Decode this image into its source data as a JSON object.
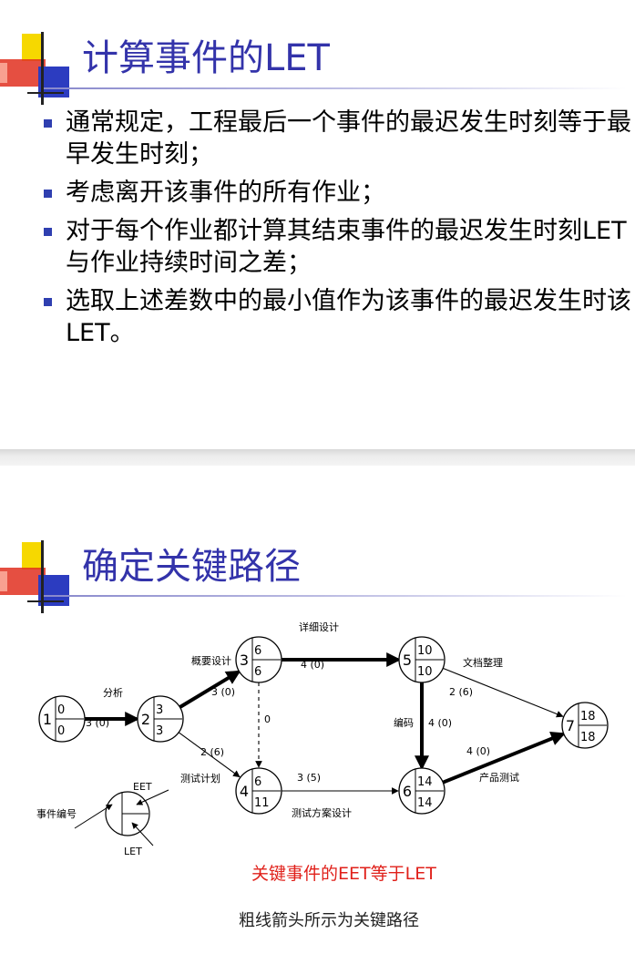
{
  "slide1": {
    "title": "计算事件的LET",
    "bullets": [
      "通常规定，工程最后一个事件的最迟发生时刻等于最早发生时刻；",
      "考虑离开该事件的所有作业；",
      "对于每个作业都计算其结束事件的最迟发生时刻LET与作业持续时间之差；",
      "选取上述差数中的最小值作为该事件的最迟发生时该LET。"
    ]
  },
  "slide2": {
    "title": "确定关键路径",
    "legend": {
      "eet_label": "EET",
      "event_label": "事件编号",
      "let_label": "LET"
    },
    "nodes": [
      {
        "id": "1",
        "eet": "0",
        "let": "0"
      },
      {
        "id": "2",
        "eet": "3",
        "let": "3"
      },
      {
        "id": "3",
        "eet": "6",
        "let": "6"
      },
      {
        "id": "4",
        "eet": "6",
        "let": "11"
      },
      {
        "id": "5",
        "eet": "10",
        "let": "10"
      },
      {
        "id": "6",
        "eet": "14",
        "let": "14"
      },
      {
        "id": "7",
        "eet": "18",
        "let": "18"
      }
    ],
    "edges": [
      {
        "from": "1",
        "to": "2",
        "name": "分析",
        "duration": "3 (0)",
        "critical": true
      },
      {
        "from": "2",
        "to": "3",
        "name": "概要设计",
        "duration": "3 (0)",
        "critical": true
      },
      {
        "from": "2",
        "to": "4",
        "name": "测试计划",
        "duration": "2 (6)",
        "critical": false
      },
      {
        "from": "3",
        "to": "4",
        "name": "",
        "duration": "0",
        "critical": false,
        "dummy": true
      },
      {
        "from": "3",
        "to": "5",
        "name": "详细设计",
        "duration": "4 (0)",
        "critical": true
      },
      {
        "from": "4",
        "to": "6",
        "name": "测试方案设计",
        "duration": "3 (5)",
        "critical": false
      },
      {
        "from": "5",
        "to": "6",
        "name": "编码",
        "duration": "4 (0)",
        "critical": true
      },
      {
        "from": "5",
        "to": "7",
        "name": "文档整理",
        "duration": "2 (6)",
        "critical": false
      },
      {
        "from": "6",
        "to": "7",
        "name": "产品测试",
        "duration": "4 (0)",
        "critical": true
      }
    ],
    "caption_red": "关键事件的EET等于LET",
    "caption_black": "粗线箭头所示为关键路径"
  }
}
